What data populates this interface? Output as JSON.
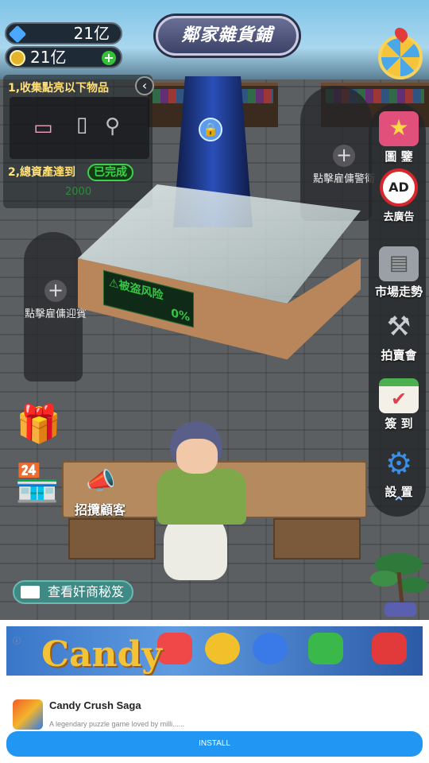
{
  "header": {
    "title": "鄰家雜貨鋪",
    "diamonds": "21亿",
    "coins": "21亿"
  },
  "quest": {
    "task1": "1,收集點亮以下物品",
    "task2": "2,總資產達到",
    "status": "已完成",
    "target": "2000"
  },
  "shop": {
    "hire_left": "點擊雇傭迎賓",
    "hire_right": "點擊雇傭警衛",
    "theft_risk_label": "⚠被盗风险",
    "theft_risk_value": "0%",
    "recruit_label": "招攬顧客",
    "video_label": "查看奸商秘笈"
  },
  "sidebar": {
    "items": [
      {
        "label": "圖  鑒",
        "icon": "star-book-icon"
      },
      {
        "label": "去廣告",
        "icon": "no-ad-icon"
      },
      {
        "label": "市場走勢",
        "icon": "market-chart-icon"
      },
      {
        "label": "拍賣會",
        "icon": "gavel-icon"
      },
      {
        "label": "簽  到",
        "icon": "calendar-check-icon"
      },
      {
        "label": "設  置",
        "icon": "gear-icon"
      }
    ]
  },
  "ad": {
    "title": "Candy Crush Saga",
    "subtitle": "A legendary puzzle game loved by milli......",
    "button": "INSTALL",
    "logo_text": "Candy"
  },
  "colors": {
    "accent_green": "#3ed14b",
    "install_blue": "#2196f3",
    "quest_yellow": "#ffe07a"
  }
}
